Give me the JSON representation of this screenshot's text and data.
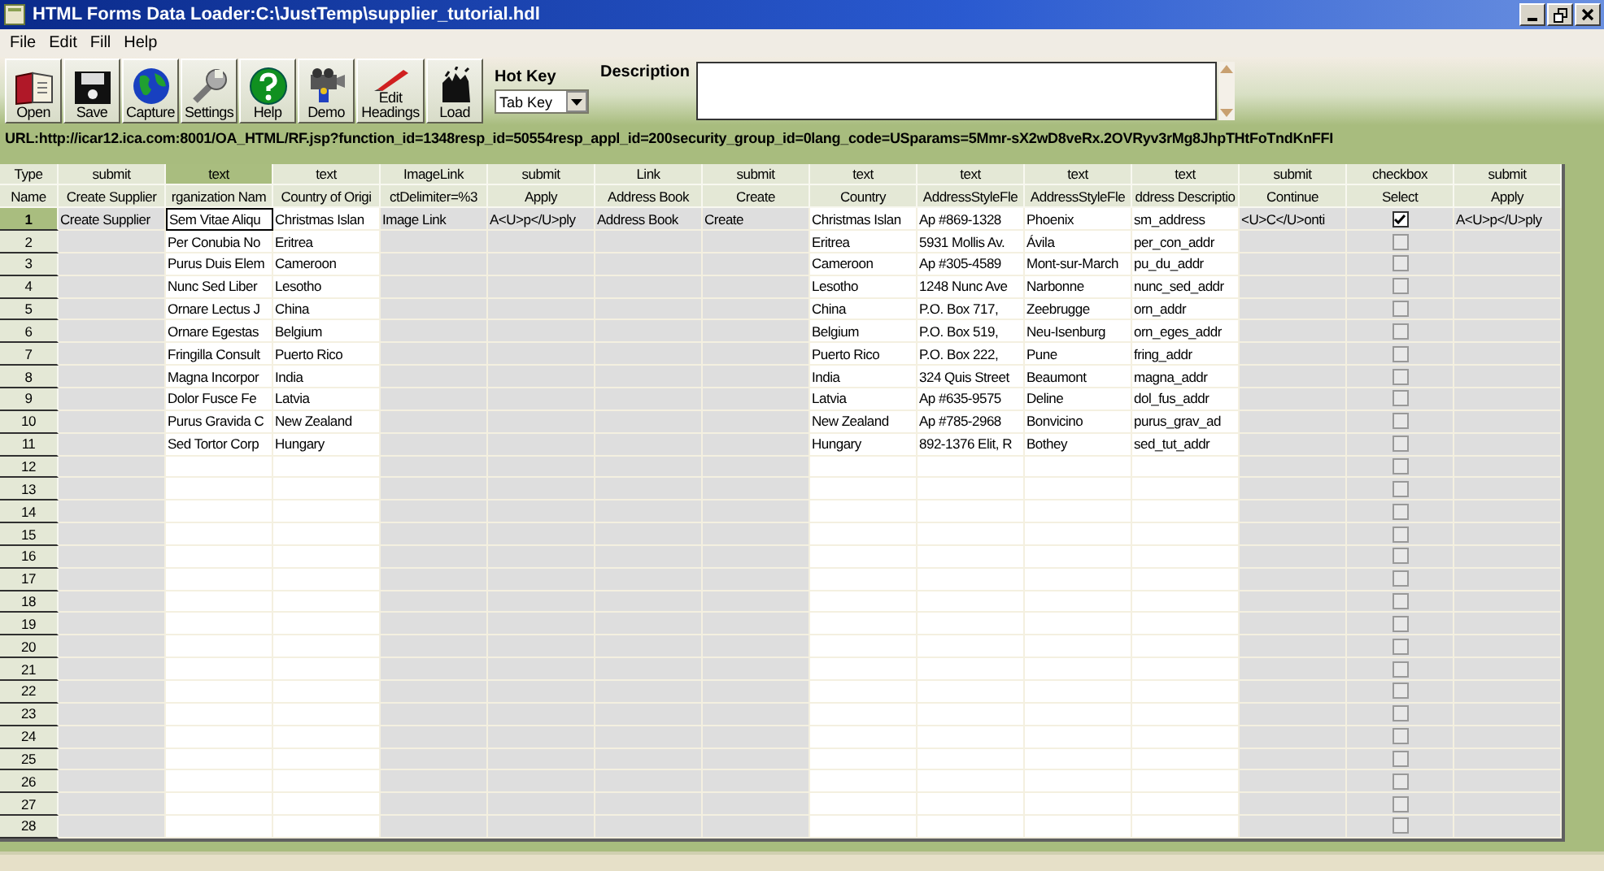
{
  "window": {
    "title": "HTML Forms Data Loader:C:\\JustTemp\\supplier_tutorial.hdl"
  },
  "menu": [
    "File",
    "Edit",
    "Fill",
    "Help"
  ],
  "toolbar": [
    {
      "label": "Open"
    },
    {
      "label": "Save"
    },
    {
      "label": "Capture"
    },
    {
      "label": "Settings"
    },
    {
      "label": "Help"
    },
    {
      "label": "Demo"
    },
    {
      "label": "Edit Headings"
    },
    {
      "label": "Load"
    }
  ],
  "hot_key": {
    "label": "Hot Key",
    "value": "Tab Key"
  },
  "description": {
    "label": "Description"
  },
  "url": "URL:http://icar12.ica.com:8001/OA_HTML/RF.jsp?function_id=1348resp_id=50554resp_appl_id=200security_group_id=0lang_code=USparams=5Mmr-sX2wD8veRx.2OVRyv3rMg8JhpTHtFoTndKnFFI",
  "table": {
    "type_label": "Type",
    "name_label": "Name",
    "columns": [
      {
        "type": "submit",
        "name": "Create Supplier",
        "kind": "action",
        "selected": false
      },
      {
        "type": "text",
        "name": "rganization Nam",
        "kind": "field",
        "selected": true
      },
      {
        "type": "text",
        "name": "Country of Origi",
        "kind": "field",
        "selected": false
      },
      {
        "type": "ImageLink",
        "name": "ctDelimiter=%3",
        "kind": "action",
        "selected": false
      },
      {
        "type": "submit",
        "name": "Apply",
        "kind": "action",
        "selected": false
      },
      {
        "type": "Link",
        "name": "Address Book",
        "kind": "action",
        "selected": false
      },
      {
        "type": "submit",
        "name": "Create",
        "kind": "action",
        "selected": false
      },
      {
        "type": "text",
        "name": "Country",
        "kind": "field",
        "selected": false
      },
      {
        "type": "text",
        "name": "AddressStyleFle",
        "kind": "field",
        "selected": false
      },
      {
        "type": "text",
        "name": "AddressStyleFle",
        "kind": "field",
        "selected": false
      },
      {
        "type": "text",
        "name": "ddress Descriptio",
        "kind": "field",
        "selected": false
      },
      {
        "type": "submit",
        "name": "Continue",
        "kind": "action",
        "selected": false
      },
      {
        "type": "checkbox",
        "name": "Select",
        "kind": "checkbox",
        "selected": false
      },
      {
        "type": "submit",
        "name": "Apply",
        "kind": "action",
        "selected": false
      }
    ],
    "rows": [
      {
        "label": "1",
        "selected": true,
        "checked": true,
        "cells": [
          "Create Supplier",
          "Sem Vitae Aliqu",
          "Christmas Islan",
          "Image Link",
          "A<U>p</U>ply",
          "Address Book",
          "Create",
          "Christmas Islan",
          "Ap #869-1328",
          "Phoenix",
          "sm_address",
          "<U>C</U>onti",
          null,
          "A<U>p</U>ply"
        ]
      },
      {
        "label": "2",
        "selected": false,
        "checked": false,
        "cells": [
          null,
          "Per Conubia No",
          "Eritrea",
          null,
          null,
          null,
          null,
          "Eritrea",
          "5931 Mollis Av.",
          "Ávila",
          "per_con_addr",
          null,
          null,
          null
        ]
      },
      {
        "label": "3",
        "selected": false,
        "checked": false,
        "cells": [
          null,
          "Purus Duis Elem",
          "Cameroon",
          null,
          null,
          null,
          null,
          "Cameroon",
          "Ap #305-4589",
          "Mont-sur-March",
          "pu_du_addr",
          null,
          null,
          null
        ]
      },
      {
        "label": "4",
        "selected": false,
        "checked": false,
        "cells": [
          null,
          "Nunc Sed Liber",
          "Lesotho",
          null,
          null,
          null,
          null,
          "Lesotho",
          "1248 Nunc Ave",
          "Narbonne",
          "nunc_sed_addr",
          null,
          null,
          null
        ]
      },
      {
        "label": "5",
        "selected": false,
        "checked": false,
        "cells": [
          null,
          "Ornare Lectus J",
          "China",
          null,
          null,
          null,
          null,
          "China",
          "P.O. Box 717,",
          "Zeebrugge",
          "orn_addr",
          null,
          null,
          null
        ]
      },
      {
        "label": "6",
        "selected": false,
        "checked": false,
        "cells": [
          null,
          "Ornare Egestas",
          "Belgium",
          null,
          null,
          null,
          null,
          "Belgium",
          "P.O. Box 519,",
          "Neu-Isenburg",
          "orn_eges_addr",
          null,
          null,
          null
        ]
      },
      {
        "label": "7",
        "selected": false,
        "checked": false,
        "cells": [
          null,
          "Fringilla Consult",
          "Puerto Rico",
          null,
          null,
          null,
          null,
          "Puerto Rico",
          "P.O. Box 222,",
          "Pune",
          "fring_addr",
          null,
          null,
          null
        ]
      },
      {
        "label": "8",
        "selected": false,
        "checked": false,
        "cells": [
          null,
          "Magna Incorpor",
          "India",
          null,
          null,
          null,
          null,
          "India",
          "324 Quis Street",
          "Beaumont",
          "magna_addr",
          null,
          null,
          null
        ]
      },
      {
        "label": "9",
        "selected": false,
        "checked": false,
        "cells": [
          null,
          "Dolor Fusce Fe",
          "Latvia",
          null,
          null,
          null,
          null,
          "Latvia",
          "Ap #635-9575",
          "Deline",
          "dol_fus_addr",
          null,
          null,
          null
        ]
      },
      {
        "label": "10",
        "selected": false,
        "checked": false,
        "cells": [
          null,
          "Purus Gravida C",
          "New Zealand",
          null,
          null,
          null,
          null,
          "New Zealand",
          "Ap #785-2968",
          "Bonvicino",
          "purus_grav_ad",
          null,
          null,
          null
        ]
      },
      {
        "label": "11",
        "selected": false,
        "checked": false,
        "cells": [
          null,
          "Sed Tortor Corp",
          "Hungary",
          null,
          null,
          null,
          null,
          "Hungary",
          "892-1376 Elit, R",
          "Bothey",
          "sed_tut_addr",
          null,
          null,
          null
        ]
      },
      {
        "label": "12",
        "selected": false,
        "checked": false
      },
      {
        "label": "13",
        "selected": false,
        "checked": false
      },
      {
        "label": "14",
        "selected": false,
        "checked": false
      },
      {
        "label": "15",
        "selected": false,
        "checked": false
      },
      {
        "label": "16",
        "selected": false,
        "checked": false
      },
      {
        "label": "17",
        "selected": false,
        "checked": false
      },
      {
        "label": "18",
        "selected": false,
        "checked": false
      },
      {
        "label": "19",
        "selected": false,
        "checked": false
      },
      {
        "label": "20",
        "selected": false,
        "checked": false
      },
      {
        "label": "21",
        "selected": false,
        "checked": false
      },
      {
        "label": "22",
        "selected": false,
        "checked": false
      },
      {
        "label": "23",
        "selected": false,
        "checked": false
      },
      {
        "label": "24",
        "selected": false,
        "checked": false
      },
      {
        "label": "25",
        "selected": false,
        "checked": false
      },
      {
        "label": "26",
        "selected": false,
        "checked": false
      },
      {
        "label": "27",
        "selected": false,
        "checked": false
      },
      {
        "label": "28",
        "selected": false,
        "checked": false
      }
    ]
  }
}
